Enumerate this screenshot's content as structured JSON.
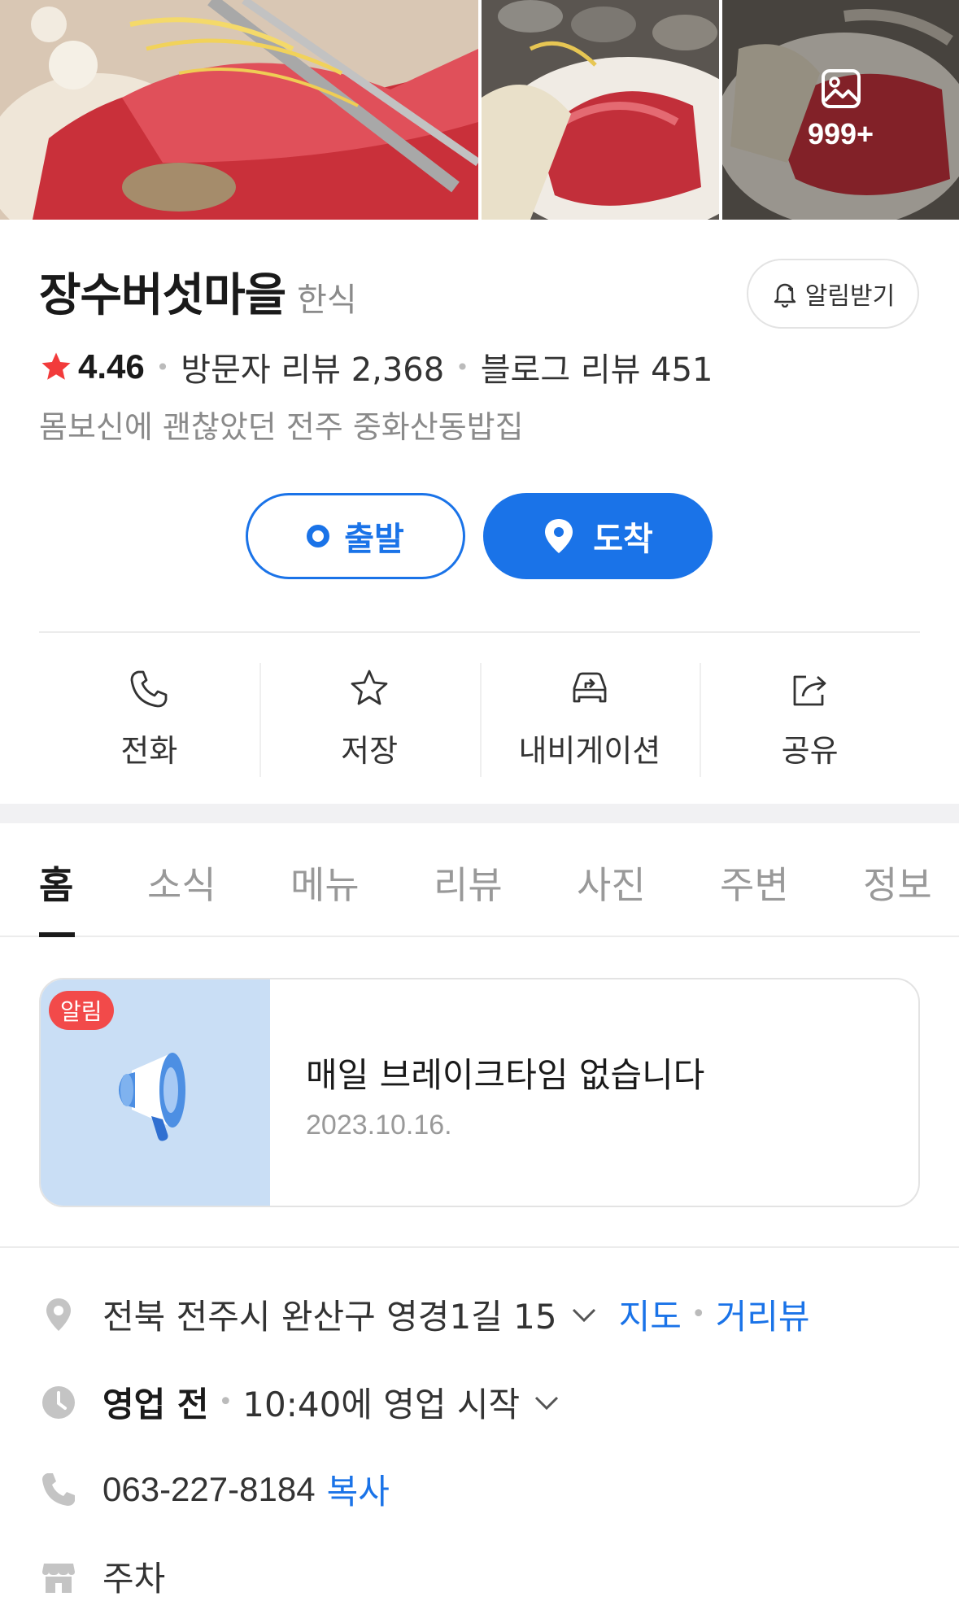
{
  "photos": {
    "more_count": "999+"
  },
  "place": {
    "name": "장수버섯마을",
    "category": "한식",
    "notify_label": "알림받기",
    "rating": "4.46",
    "visitor_reviews": "방문자 리뷰 2,368",
    "blog_reviews": "블로그 리뷰 451",
    "description": "몸보신에 괜찮았던 전주 중화산동밥집"
  },
  "route": {
    "start_label": "출발",
    "arrive_label": "도착"
  },
  "actions": [
    {
      "label": "전화",
      "icon": "phone-icon"
    },
    {
      "label": "저장",
      "icon": "star-icon"
    },
    {
      "label": "내비게이션",
      "icon": "car-nav-icon"
    },
    {
      "label": "공유",
      "icon": "share-icon"
    }
  ],
  "tabs": [
    "홈",
    "소식",
    "메뉴",
    "리뷰",
    "사진",
    "주변",
    "정보"
  ],
  "notice": {
    "badge": "알림",
    "title": "매일 브레이크타임 없습니다",
    "date": "2023.10.16."
  },
  "info": {
    "address": "전북 전주시 완산구 영경1길 15",
    "map_link": "지도",
    "street_link": "거리뷰",
    "hours_status": "영업 전",
    "hours_detail": "10:40에 영업 시작",
    "phone": "063-227-8184",
    "copy_link": "복사",
    "parking": "주차"
  },
  "colors": {
    "accent": "#1a73e8",
    "star": "#f23b3b",
    "badge": "#f24a4a"
  }
}
